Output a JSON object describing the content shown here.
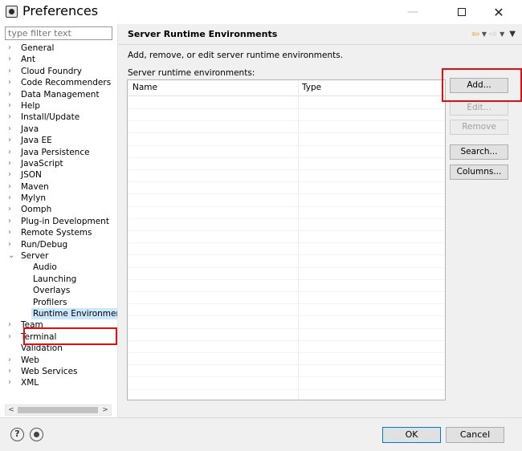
{
  "window": {
    "title": "Preferences",
    "minimize_label": "—",
    "close_label": "✕"
  },
  "left": {
    "filter_placeholder": "type filter text",
    "tree": [
      {
        "label": "General",
        "expandable": true
      },
      {
        "label": "Ant",
        "expandable": true
      },
      {
        "label": "Cloud Foundry",
        "expandable": true
      },
      {
        "label": "Code Recommenders",
        "expandable": true
      },
      {
        "label": "Data Management",
        "expandable": true
      },
      {
        "label": "Help",
        "expandable": true
      },
      {
        "label": "Install/Update",
        "expandable": true
      },
      {
        "label": "Java",
        "expandable": true
      },
      {
        "label": "Java EE",
        "expandable": true
      },
      {
        "label": "Java Persistence",
        "expandable": true
      },
      {
        "label": "JavaScript",
        "expandable": true
      },
      {
        "label": "JSON",
        "expandable": true
      },
      {
        "label": "Maven",
        "expandable": true
      },
      {
        "label": "Mylyn",
        "expandable": true
      },
      {
        "label": "Oomph",
        "expandable": true
      },
      {
        "label": "Plug-in Development",
        "expandable": true
      },
      {
        "label": "Remote Systems",
        "expandable": true
      },
      {
        "label": "Run/Debug",
        "expandable": true
      },
      {
        "label": "Server",
        "expandable": true,
        "expanded": true
      },
      {
        "label": "Audio",
        "child": true
      },
      {
        "label": "Launching",
        "child": true
      },
      {
        "label": "Overlays",
        "child": true
      },
      {
        "label": "Profilers",
        "child": true
      },
      {
        "label": "Runtime Environments",
        "child": true,
        "selected": true
      },
      {
        "label": "Team",
        "expandable": true
      },
      {
        "label": "Terminal",
        "expandable": true
      },
      {
        "label": "Validation",
        "expandable": false
      },
      {
        "label": "Web",
        "expandable": true
      },
      {
        "label": "Web Services",
        "expandable": true
      },
      {
        "label": "XML",
        "expandable": true
      }
    ]
  },
  "page": {
    "title": "Server Runtime Environments",
    "description": "Add, remove, or edit server runtime environments.",
    "table_label": "Server runtime environments:",
    "columns": [
      "Name",
      "Type"
    ],
    "buttons": {
      "add": "Add...",
      "edit": "Edit...",
      "remove": "Remove",
      "search": "Search...",
      "columns": "Columns..."
    }
  },
  "bottom": {
    "ok": "OK",
    "cancel": "Cancel",
    "help_symbol": "?"
  },
  "colors": {
    "highlight": "#e01010",
    "selection": "#cce8ff",
    "back_arrow": "#d4a017"
  }
}
